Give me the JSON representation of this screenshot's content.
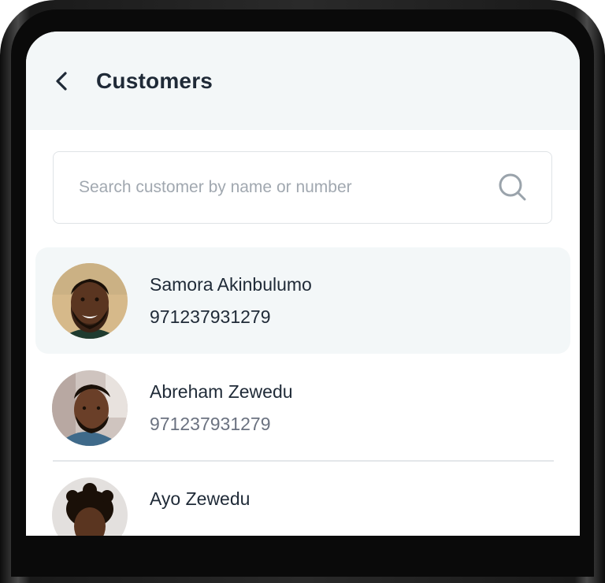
{
  "header": {
    "title": "Customers",
    "back_icon": "chevron-left-icon"
  },
  "search": {
    "placeholder": "Search customer by name or number",
    "icon": "search-icon"
  },
  "customers": [
    {
      "name": "Samora Akinbulumo",
      "phone": "971237931279",
      "selected": true
    },
    {
      "name": "Abreham Zewedu",
      "phone": "971237931279",
      "selected": false
    },
    {
      "name": "Ayo Zewedu",
      "phone": "",
      "selected": false
    }
  ],
  "colors": {
    "header_bg": "#f3f7f8",
    "text_primary": "#1f2a37",
    "text_secondary": "#6b7280",
    "selected_row_bg": "#f3f7f8",
    "border": "#dfe3e6"
  }
}
